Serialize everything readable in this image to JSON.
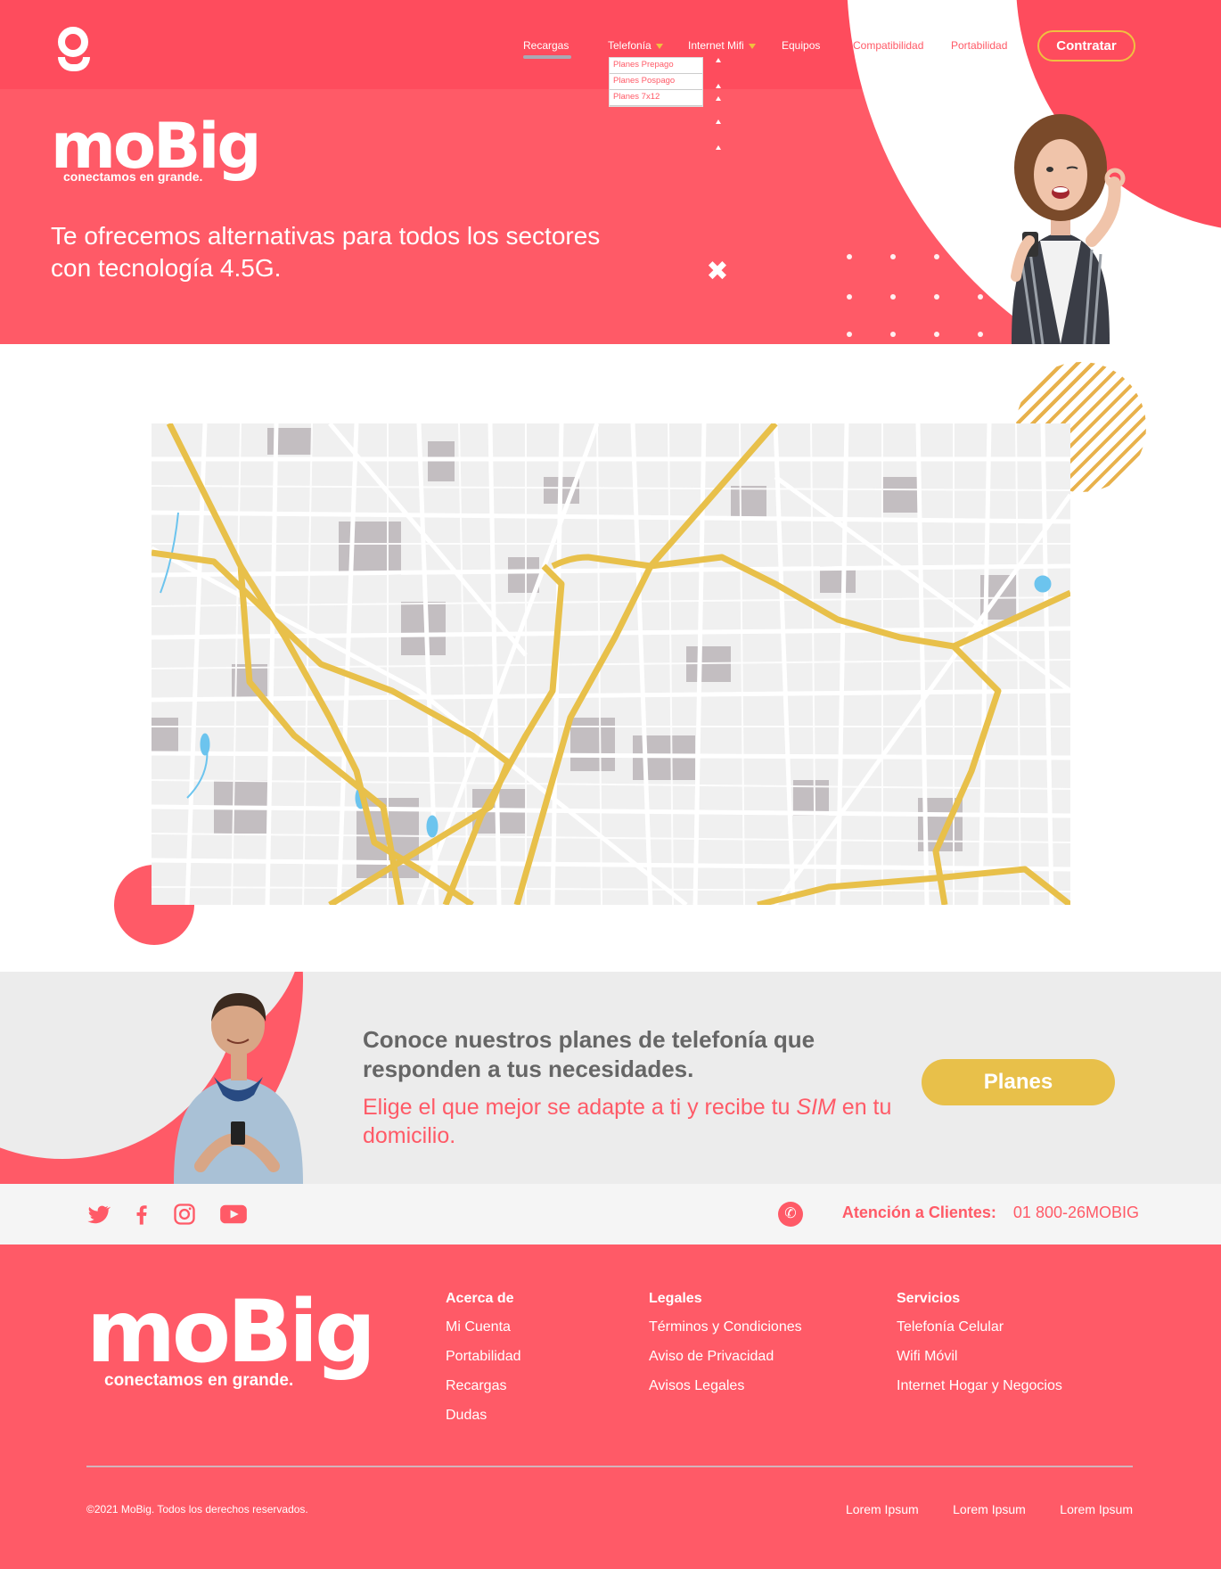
{
  "header": {
    "nav": {
      "recargas": "Recargas",
      "telefonia": "Telefonía",
      "internet_mifi": "Internet Mifi",
      "equipos": "Equipos",
      "compatibilidad": "Compatibilidad",
      "portabilidad": "Portabilidad"
    },
    "dropdown": [
      "Planes Prepago",
      "Planes Pospago",
      "Planes 7x12"
    ],
    "cta": "Contratar"
  },
  "hero": {
    "brand": "moBig",
    "tagline": "conectamos en grande.",
    "headline": "Te ofrecemos alternativas para todos los sectores con tecnología 4.5G.",
    "close_glyph": "✖"
  },
  "promo": {
    "title": "Conoce nuestros planes de telefonía que responden a tus necesidades.",
    "sub_before": "Elige el que mejor se adapte a ti y recibe tu ",
    "sub_em": "SIM",
    "sub_after": " en tu domicilio.",
    "button": "Planes"
  },
  "social": {
    "icons": [
      "twitter-icon",
      "facebook-icon",
      "instagram-icon",
      "youtube-icon"
    ],
    "support_label": "Atención a Clientes:",
    "support_phone": "01 800-26MOBIG"
  },
  "footer": {
    "brand": "moBig",
    "tagline": "conectamos en grande.",
    "columns": [
      {
        "title": "Acerca de",
        "links": [
          "Mi Cuenta",
          "Portabilidad",
          "Recargas",
          "Dudas"
        ]
      },
      {
        "title": "Legales",
        "links": [
          "Términos y Condiciones",
          "Aviso de Privacidad",
          "Avisos Legales"
        ]
      },
      {
        "title": "Servicios",
        "links": [
          "Telefonía Celular",
          "Wifi Móvil",
          "Internet Hogar y Negocios"
        ]
      }
    ],
    "copyright": "©2021 MoBig. Todos los derechos reservados.",
    "bottom_links": [
      "Lorem Ipsum",
      "Lorem Ipsum",
      "Lorem Ipsum"
    ]
  },
  "colors": {
    "brand_pink": "#ff5a67",
    "accent_yellow": "#e8c04a",
    "map_road": "#e8c04a"
  }
}
